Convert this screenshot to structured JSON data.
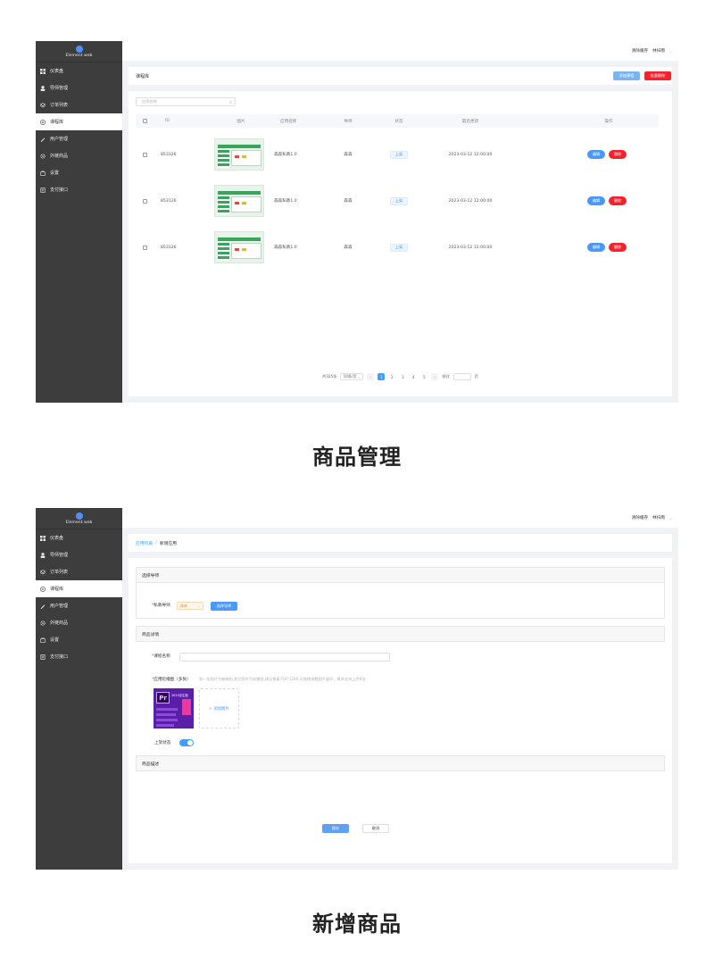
{
  "common": {
    "brand": "Element web",
    "topbar": {
      "clear_cache": "清除缓存",
      "user": "林扫雨"
    },
    "nav": [
      {
        "label": "仪表盘",
        "icon": "dashboard-icon"
      },
      {
        "label": "导师管理",
        "icon": "user-icon"
      },
      {
        "label": "订单列表",
        "icon": "layers-icon"
      },
      {
        "label": "课程库",
        "icon": "circle-play-icon"
      },
      {
        "label": "用户管理",
        "icon": "pen-icon"
      },
      {
        "label": "外链商品",
        "icon": "gear-icon"
      },
      {
        "label": "设置",
        "icon": "bag-icon"
      },
      {
        "label": "支付接口",
        "icon": "document-icon"
      }
    ],
    "active_nav_index": 3
  },
  "product_list": {
    "header_title": "课程库",
    "add_button": "添加课程",
    "batch_delete_button": "批量删除",
    "search_placeholder": "应用名称",
    "columns": [
      "ID",
      "图片",
      "应用名称",
      "导师",
      "状态",
      "最后更新",
      "操作"
    ],
    "rows": [
      {
        "id": "853126",
        "name": "森森私教1.0",
        "tutor": "森森",
        "status": "上架",
        "updated": "2023-03-12 12:00:00"
      },
      {
        "id": "853126",
        "name": "森森私教1.0",
        "tutor": "森森",
        "status": "上架",
        "updated": "2023-03-12 12:00:00"
      },
      {
        "id": "853126",
        "name": "森森私教1.0",
        "tutor": "森森",
        "status": "上架",
        "updated": "2023-03-12 12:00:00"
      }
    ],
    "edit_label": "编辑",
    "delete_label": "删除",
    "pagination": {
      "total": "共325条",
      "page_size": "10条/页",
      "pages": [
        "1",
        "2",
        "3",
        "4",
        "5"
      ],
      "current_page": "1",
      "goto": "前往",
      "page_unit": "页"
    },
    "caption": "商品管理"
  },
  "add_product": {
    "breadcrumb": {
      "parent": "应用列表",
      "current": "新增应用"
    },
    "section_tutor": "选择导师",
    "private_tutor_label": "私教导师",
    "tutor_select_value": "森森",
    "select_tutor_button": "选择导师",
    "section_detail": "商品详情",
    "course_name_label": "课程名称",
    "carousel_label": "应用轮播图（多张）",
    "carousel_hint": "第一张图片为缩略图,其它图片为轮播图,建议像素750*1280,可拖拽调整图片顺序，最多支持上传8张",
    "add_image": "+ 添加图片",
    "status_label": "上架状态",
    "status_on": true,
    "section_description": "商品描述",
    "save_button": "保存",
    "cancel_button": "取消",
    "caption": "新增商品",
    "poster": {
      "year": "2023全生能"
    }
  }
}
